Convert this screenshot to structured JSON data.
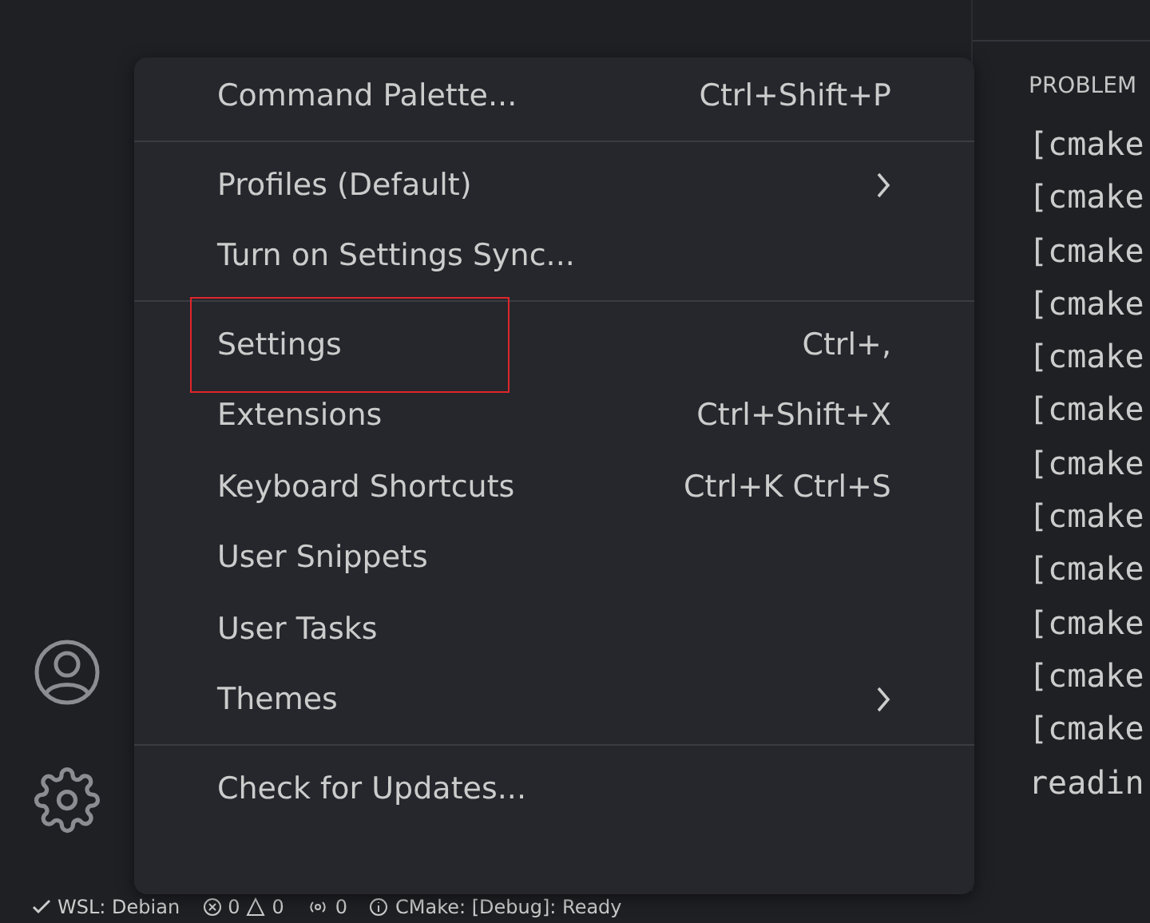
{
  "panel": {
    "tab": "PROBLEM",
    "lines": [
      "[cmake",
      "[cmake",
      "[cmake",
      "[cmake",
      "[cmake",
      "[cmake",
      "[cmake",
      "[cmake",
      "[cmake",
      "[cmake",
      "[cmake",
      "[cmake",
      "readin"
    ]
  },
  "menu": {
    "groups": [
      [
        {
          "label": "Command Palette...",
          "shortcut": "Ctrl+Shift+P",
          "kind": "command",
          "highlighted": false
        }
      ],
      [
        {
          "label": "Profiles (Default)",
          "kind": "submenu",
          "highlighted": false
        },
        {
          "label": "Turn on Settings Sync...",
          "kind": "command",
          "highlighted": false
        }
      ],
      [
        {
          "label": "Settings",
          "shortcut": "Ctrl+,",
          "kind": "command",
          "highlighted": true
        },
        {
          "label": "Extensions",
          "shortcut": "Ctrl+Shift+X",
          "kind": "command",
          "highlighted": false
        },
        {
          "label": "Keyboard Shortcuts",
          "shortcut": "Ctrl+K Ctrl+S",
          "kind": "command",
          "highlighted": false
        },
        {
          "label": "User Snippets",
          "kind": "command",
          "highlighted": false
        },
        {
          "label": "User Tasks",
          "kind": "command",
          "highlighted": false
        },
        {
          "label": "Themes",
          "kind": "submenu",
          "highlighted": false
        }
      ],
      [
        {
          "label": "Check for Updates...",
          "kind": "command",
          "highlighted": false
        }
      ]
    ]
  },
  "status_bar": {
    "remote": "WSL: Debian",
    "errors": "0",
    "warnings": "0",
    "ports": "0",
    "cmake": "CMake: [Debug]: Ready"
  }
}
